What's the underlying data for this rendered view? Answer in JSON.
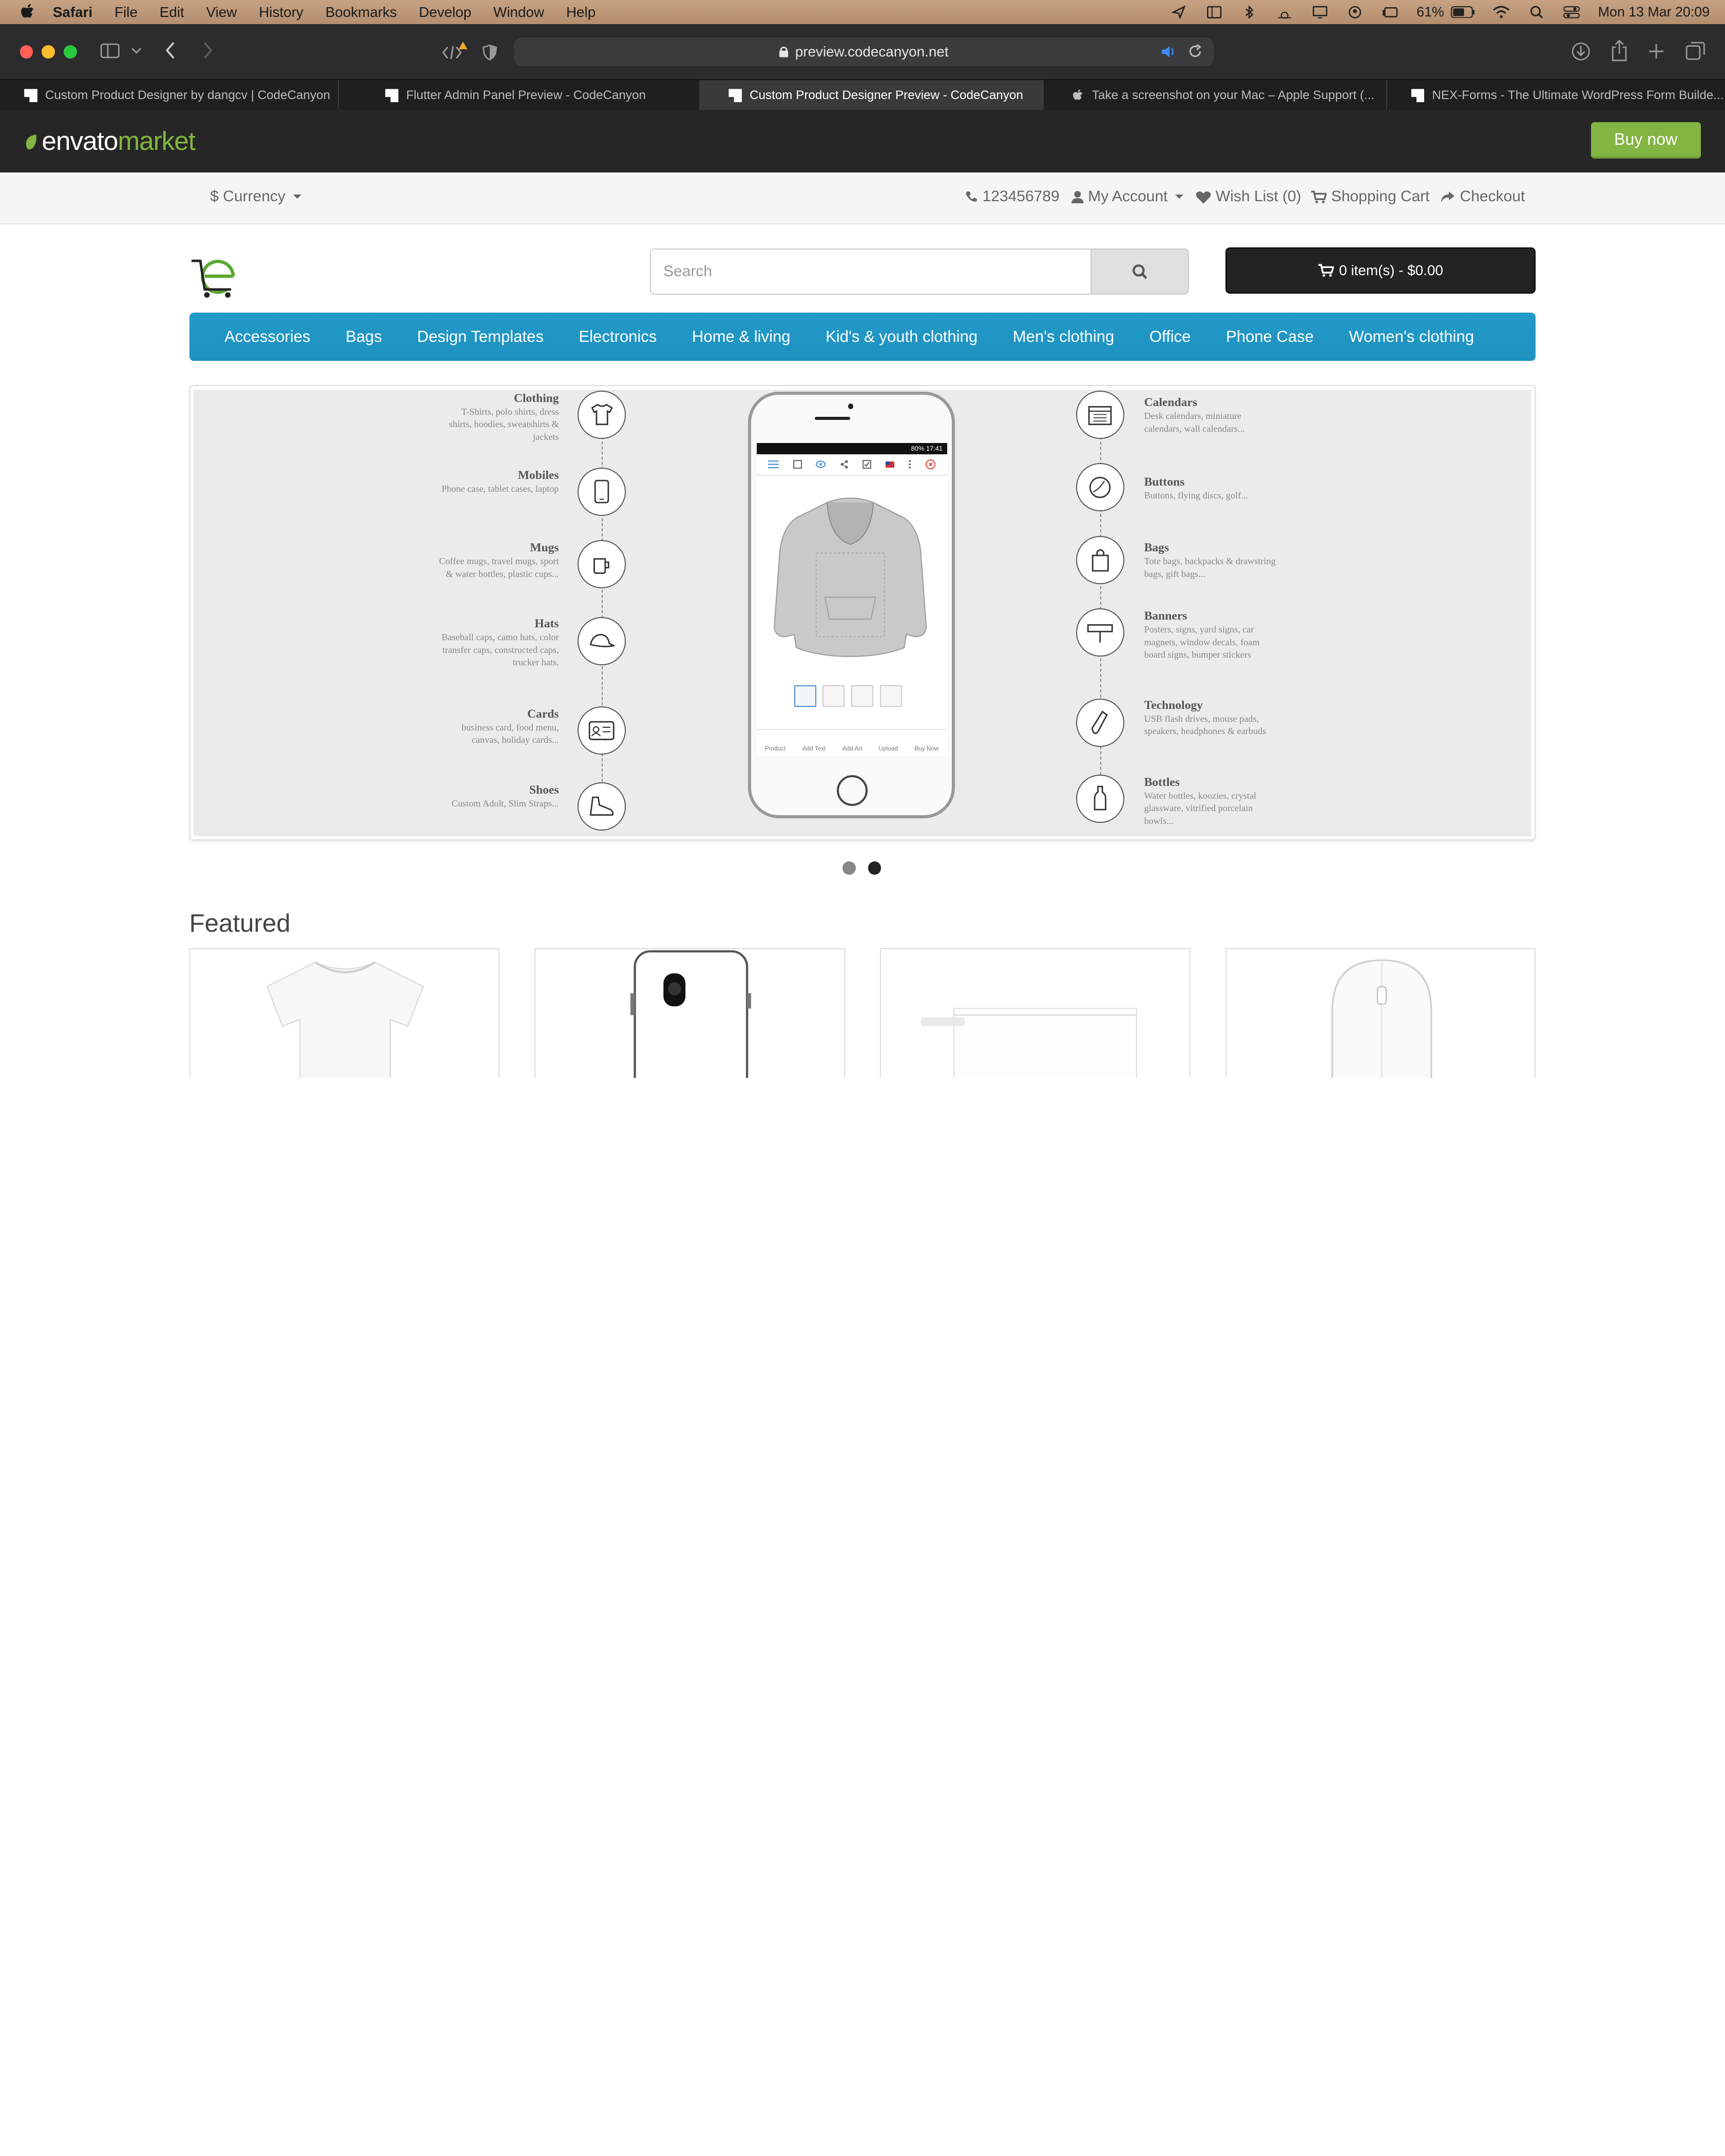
{
  "menubar": {
    "app": "Safari",
    "items": [
      "File",
      "Edit",
      "View",
      "History",
      "Bookmarks",
      "Develop",
      "Window",
      "Help"
    ],
    "battery": "61%",
    "clock": "Mon 13 Mar  20:09"
  },
  "browser": {
    "url": "preview.codecanyon.net",
    "tabs": [
      {
        "label": "Custom Product Designer by dangcv | CodeCanyon",
        "active": false
      },
      {
        "label": "Flutter Admin Panel Preview - CodeCanyon",
        "active": false
      },
      {
        "label": "Custom Product Designer Preview - CodeCanyon",
        "active": true
      },
      {
        "label": "Take a screenshot on your Mac – Apple Support (...",
        "active": false
      },
      {
        "label": "NEX-Forms - The Ultimate WordPress Form Builde...",
        "active": false
      }
    ]
  },
  "envato": {
    "logo_a": "envato",
    "logo_b": "market",
    "buy_now": "Buy now",
    "brand_color": "#82b541"
  },
  "topbar": {
    "currency": "$ Currency",
    "phone": "123456789",
    "account": "My Account",
    "wishlist": "Wish List (0)",
    "cart": "Shopping Cart",
    "checkout": "Checkout"
  },
  "header": {
    "search_placeholder": "Search",
    "cart_summary": "0 item(s) - $0.00"
  },
  "nav": [
    "Accessories",
    "Bags",
    "Design Templates",
    "Electronics",
    "Home & living",
    "Kid's & youth clothing",
    "Men's clothing",
    "Office",
    "Phone Case",
    "Women's clothing"
  ],
  "banner": {
    "left": [
      {
        "title": "Clothing",
        "desc": "T-Shirts, polo shirts, dress shirts, hoodies, sweatshirts & jackets",
        "icon": "tshirt-icon"
      },
      {
        "title": "Mobiles",
        "desc": "Phone case, tablet cases, laptop",
        "icon": "mobile-icon"
      },
      {
        "title": "Mugs",
        "desc": "Coffee mugs, travel mugs, sport & water bottles, plastic cups...",
        "icon": "mug-icon"
      },
      {
        "title": "Hats",
        "desc": "Baseball caps, camo hats, color transfer caps, constructed caps, trucker hats.",
        "icon": "cap-icon"
      },
      {
        "title": "Cards",
        "desc": "business card, food menu, canvas, holiday cards...",
        "icon": "id-card-icon"
      },
      {
        "title": "Shoes",
        "desc": "Custom Adult, Slim Straps...",
        "icon": "shoe-icon"
      }
    ],
    "right": [
      {
        "title": "Calendars",
        "desc": "Desk calendars, miniature calendars, wall calendars...",
        "icon": "calendar-icon"
      },
      {
        "title": "Buttons",
        "desc": "Buttons,  flying discs, golf...",
        "icon": "badge-button-icon"
      },
      {
        "title": "Bags",
        "desc": "Tote bags, backpacks & drawstring bags, gift bags...",
        "icon": "bag-icon"
      },
      {
        "title": "Banners",
        "desc": "Posters, signs, yard signs, car magnets, window decals, foam board signs, bumper stickers",
        "icon": "banner-sign-icon"
      },
      {
        "title": "Technology",
        "desc": "USB flash drives, mouse pads, speakers, headphones & earbuds",
        "icon": "usb-icon"
      },
      {
        "title": "Bottles",
        "desc": "Water bottles, koozies, crystal glassware, vitrified porcelain bowls...",
        "icon": "bottle-icon"
      }
    ],
    "phone_status": "80%  17:41",
    "phone_toolbar": [
      "Product",
      "Add Text",
      "Add Art",
      "Upload",
      "Buy Now"
    ],
    "slides_total": 2,
    "slide_active": 2
  },
  "featured": {
    "title": "Featured",
    "products": [
      {
        "icon": "tshirt-product"
      },
      {
        "icon": "phone-case-product"
      },
      {
        "icon": "pouch-product"
      },
      {
        "icon": "mouse-product"
      }
    ]
  }
}
